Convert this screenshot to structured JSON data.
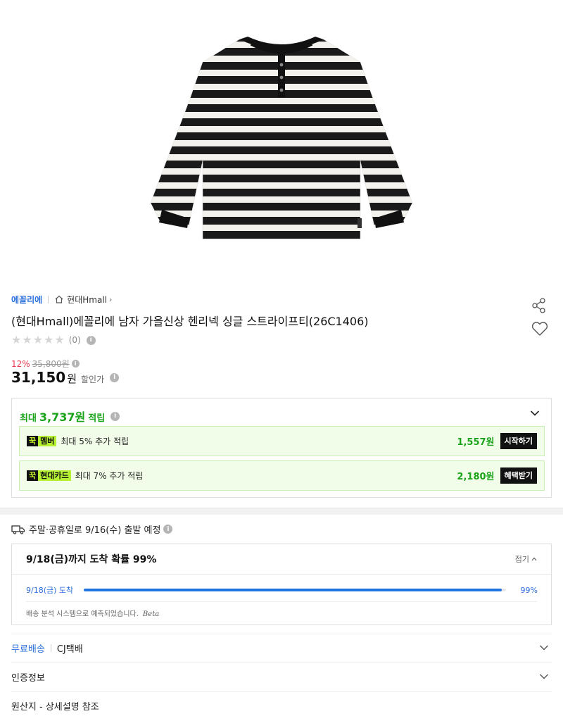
{
  "brand": {
    "name": "에꼴리에",
    "store": "현대Hmall",
    "home_icon": "home-icon",
    "chevron": "›"
  },
  "product": {
    "title": "(현대Hmall)에꼴리에 남자 가을신상 헨리넥 싱글 스트라이프티(26C1406)",
    "rating": {
      "stars": 0,
      "max_stars": 5,
      "review_count": "(0)"
    },
    "discount_rate": "12%",
    "original_price": "35,800원",
    "price": "31,150",
    "price_unit": "원",
    "price_label": "할인가"
  },
  "points": {
    "prefix": "최대",
    "amount": "3,737원",
    "suffix": "적립",
    "benefits": [
      {
        "badge_a": "꾹",
        "badge_b": "멤버",
        "text": "최대 5% 추가 적립",
        "amount": "1,557원",
        "button": "시작하기"
      },
      {
        "badge_a": "꾹",
        "badge_b": "현대카드",
        "text": "최대 7% 추가 적립",
        "amount": "2,180원",
        "button": "혜택받기"
      }
    ]
  },
  "shipping": {
    "notice": "주말·공휴일로 9/16(수) 출발 예정",
    "arrival_title": "9/18(금)까지 도착 확률 99%",
    "fold_label": "접기",
    "progress_label": "9/18(금) 도착",
    "progress_percent": "99%",
    "progress_value": 0.99,
    "note": "배송 분석 시스템으로 예측되었습니다.",
    "beta": "Beta"
  },
  "info_rows": {
    "delivery_free": "무료배송",
    "carrier": "CJ택배",
    "certification": "인증정보",
    "origin": "원산지 - 상세설명 참조"
  },
  "colors": {
    "accent_blue": "#2b6fdb",
    "point_green": "#1aa31a",
    "discount_red": "#e8384f",
    "progress_blue": "#1e74e0"
  },
  "icons": [
    "share-icon",
    "heart-icon",
    "info-icon",
    "chevron-down-icon",
    "truck-icon",
    "chevron-up-icon",
    "star-icon"
  ]
}
